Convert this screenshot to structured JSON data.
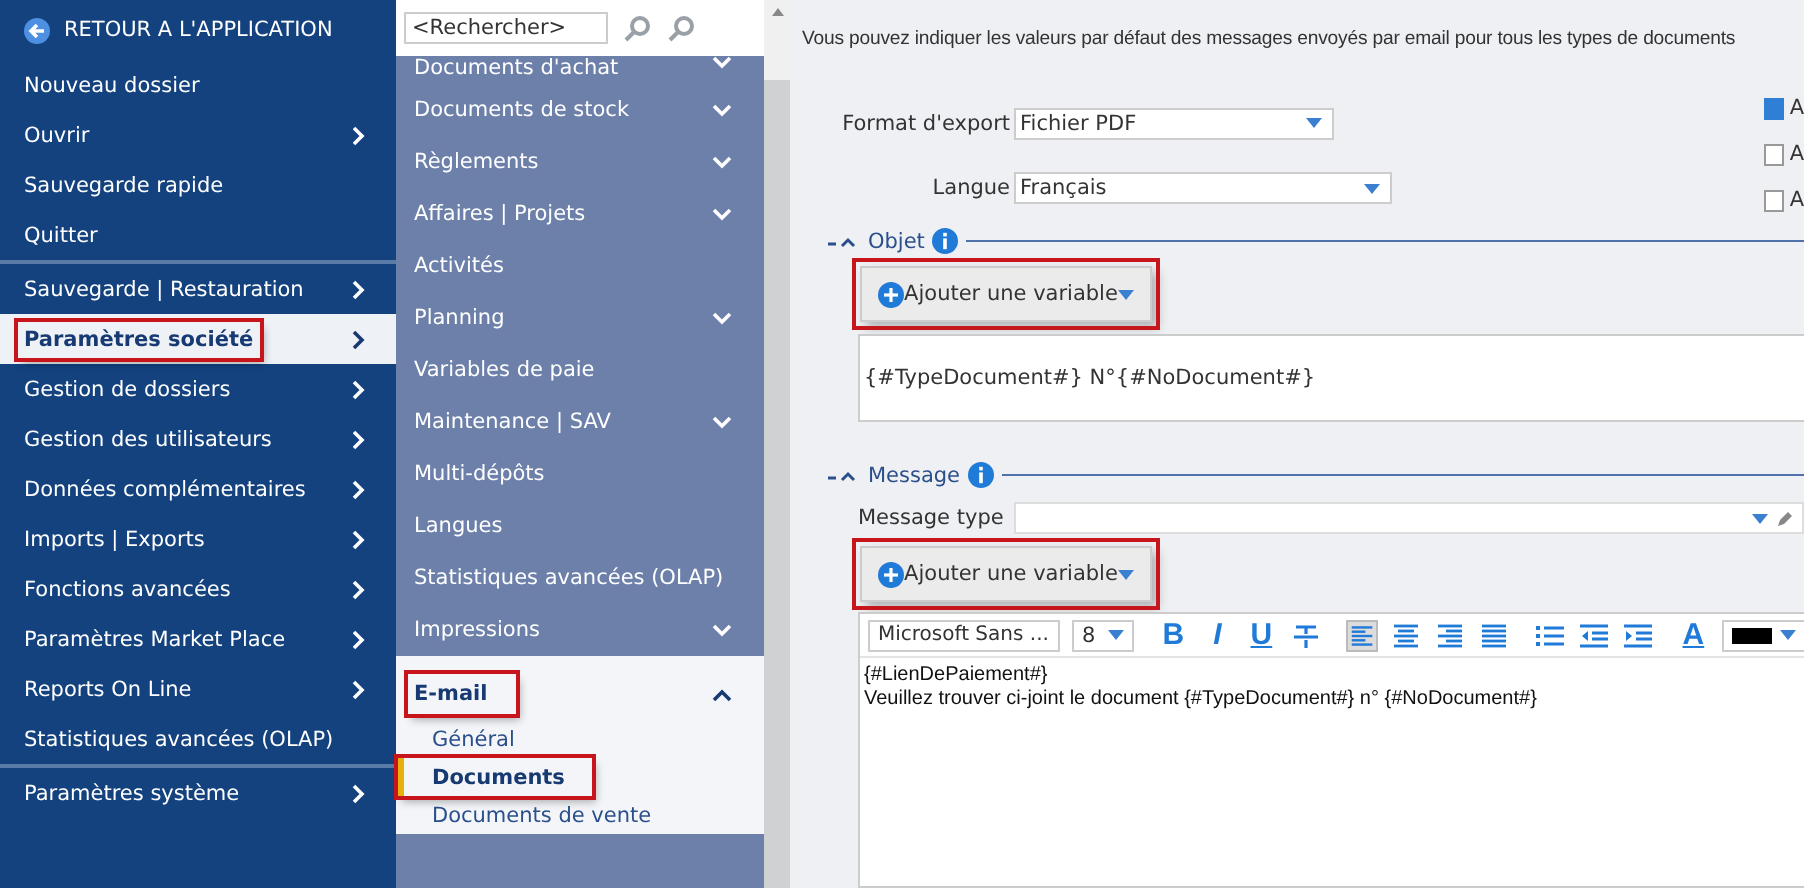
{
  "back_button": {
    "label": "RETOUR A L'APPLICATION"
  },
  "main_menu": {
    "groups": [
      {
        "items": [
          {
            "label": "Nouveau dossier",
            "has_submenu": false,
            "selected": false,
            "highlighted": false
          },
          {
            "label": "Ouvrir",
            "has_submenu": true,
            "selected": false,
            "highlighted": false
          },
          {
            "label": "Sauvegarde rapide",
            "has_submenu": false,
            "selected": false,
            "highlighted": false
          },
          {
            "label": "Quitter",
            "has_submenu": false,
            "selected": false,
            "highlighted": false
          }
        ]
      },
      {
        "items": [
          {
            "label": "Sauvegarde | Restauration",
            "has_submenu": true,
            "selected": false,
            "highlighted": false
          },
          {
            "label": "Paramètres société",
            "has_submenu": true,
            "selected": true,
            "highlighted": true
          },
          {
            "label": "Gestion de dossiers",
            "has_submenu": true,
            "selected": false,
            "highlighted": false
          },
          {
            "label": "Gestion des utilisateurs",
            "has_submenu": true,
            "selected": false,
            "highlighted": false
          },
          {
            "label": "Données complémentaires",
            "has_submenu": true,
            "selected": false,
            "highlighted": false
          },
          {
            "label": "Imports | Exports",
            "has_submenu": true,
            "selected": false,
            "highlighted": false
          },
          {
            "label": "Fonctions avancées",
            "has_submenu": true,
            "selected": false,
            "highlighted": false
          },
          {
            "label": "Paramètres Market Place",
            "has_submenu": true,
            "selected": false,
            "highlighted": false
          },
          {
            "label": "Reports On Line",
            "has_submenu": true,
            "selected": false,
            "highlighted": false
          },
          {
            "label": "Statistiques avancées (OLAP)",
            "has_submenu": false,
            "selected": false,
            "highlighted": false
          }
        ]
      },
      {
        "items": [
          {
            "label": "Paramètres système",
            "has_submenu": true,
            "selected": false,
            "highlighted": false
          }
        ]
      }
    ]
  },
  "search": {
    "placeholder": "<Rechercher>"
  },
  "sub_menu": {
    "items": [
      {
        "label": "Documents d'achat",
        "expanded": false,
        "highlighted": false
      },
      {
        "label": "Documents de stock",
        "expanded": false,
        "highlighted": false
      },
      {
        "label": "Règlements",
        "expanded": false,
        "highlighted": false
      },
      {
        "label": "Affaires | Projets",
        "expanded": false,
        "highlighted": false
      },
      {
        "label": "Activités",
        "highlighted": false
      },
      {
        "label": "Planning",
        "expanded": false,
        "highlighted": false
      },
      {
        "label": "Variables de paie",
        "highlighted": false
      },
      {
        "label": "Maintenance | SAV",
        "expanded": false,
        "highlighted": false
      },
      {
        "label": "Multi-dépôts",
        "highlighted": false
      },
      {
        "label": "Langues",
        "highlighted": false
      },
      {
        "label": "Statistiques avancées (OLAP)",
        "highlighted": false
      },
      {
        "label": "Impressions",
        "expanded": false,
        "highlighted": false
      },
      {
        "label": "E-mail",
        "expanded": true,
        "highlighted": true,
        "children": [
          {
            "label": "Général",
            "selected": false,
            "highlighted": false
          },
          {
            "label": "Documents",
            "selected": true,
            "highlighted": true
          },
          {
            "label": "Documents de vente",
            "selected": false,
            "highlighted": false
          }
        ]
      }
    ]
  },
  "description": "Vous pouvez indiquer les valeurs par défaut des messages envoyés par email pour tous les types de documents",
  "form": {
    "fields": [
      {
        "label": "Format d'export",
        "value": "Fichier PDF"
      },
      {
        "label": "Langue",
        "value": "Français"
      }
    ]
  },
  "options": [
    {
      "label": "A",
      "checked": true
    },
    {
      "label": "A",
      "checked": false
    },
    {
      "label": "A",
      "checked": false
    }
  ],
  "subject_section": {
    "title": "Objet",
    "add_variable": {
      "label": "Ajouter une variable",
      "highlighted": true
    },
    "value": "{#TypeDocument#} N°{#NoDocument#}"
  },
  "message_section": {
    "title": "Message",
    "message_type": {
      "label": "Message type"
    },
    "add_variable": {
      "label": "Ajouter une variable",
      "highlighted": true
    },
    "toolbar": {
      "font": "Microsoft Sans ...",
      "size": "8",
      "format_buttons": [
        {
          "kind": "bold",
          "label": "B"
        },
        {
          "kind": "italic",
          "label": "I"
        },
        {
          "kind": "underline",
          "label": "U"
        },
        {
          "kind": "strikethrough"
        }
      ],
      "align_buttons": [
        {
          "kind": "left",
          "selected": true
        },
        {
          "kind": "center",
          "selected": false
        },
        {
          "kind": "right",
          "selected": false
        },
        {
          "kind": "justify",
          "selected": false
        }
      ],
      "list_buttons": [
        {
          "kind": "bullets"
        },
        {
          "kind": "outdent"
        },
        {
          "kind": "indent"
        }
      ],
      "text_color": {
        "label": "A",
        "color": "#000000"
      }
    },
    "body_lines": [
      "{#LienDePaiement#}",
      "Veuillez trouver ci-joint le document {#TypeDocument#} n° {#NoDocument#}"
    ]
  }
}
